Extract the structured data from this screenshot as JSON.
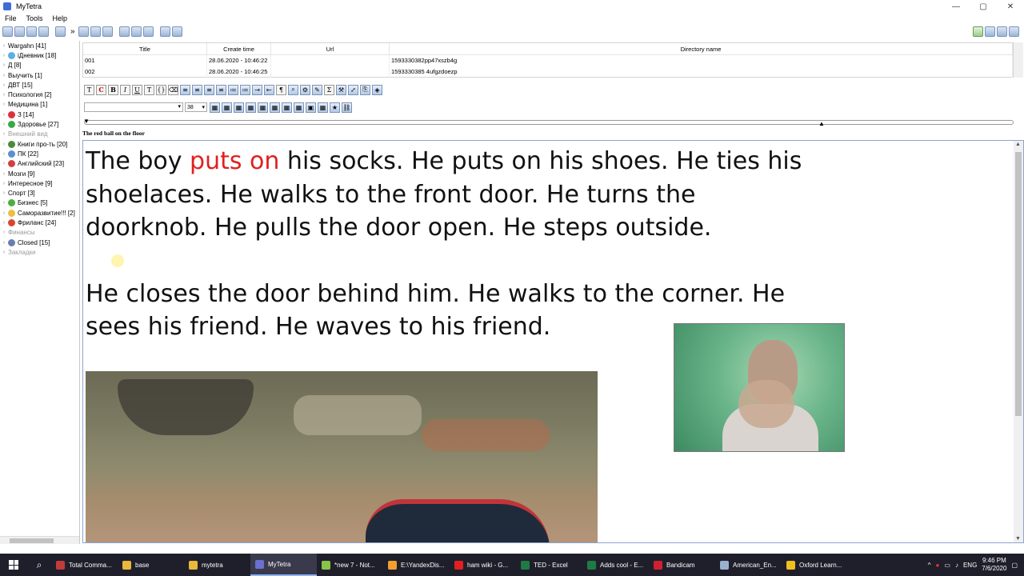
{
  "window": {
    "title": "MyTetra",
    "controls": [
      "—",
      "▢",
      "✕"
    ]
  },
  "menu": [
    "File",
    "Tools",
    "Help"
  ],
  "tree": [
    {
      "label": "Wargahn [41]",
      "icon": "",
      "grey": false
    },
    {
      "label": "iДневник [18]",
      "icon": "#5ab0e6",
      "grey": false
    },
    {
      "label": "Д [8]",
      "icon": "",
      "grey": false
    },
    {
      "label": "Выучить [1]",
      "icon": "",
      "grey": false
    },
    {
      "label": "ДВТ [15]",
      "icon": "",
      "grey": false
    },
    {
      "label": "Психология [2]",
      "icon": "",
      "grey": false
    },
    {
      "label": "Медицина [1]",
      "icon": "",
      "grey": false
    },
    {
      "label": "З [14]",
      "icon": "#e0303a",
      "grey": false
    },
    {
      "label": "Здоровье [27]",
      "icon": "#3aa845",
      "grey": false
    },
    {
      "label": "Внешний вид",
      "icon": "",
      "grey": true
    },
    {
      "label": "Книги про-ть [20]",
      "icon": "#4c8a3c",
      "grey": false
    },
    {
      "label": "ПК [22]",
      "icon": "#5a8fd0",
      "grey": false
    },
    {
      "label": "Английский [23]",
      "icon": "#d04040",
      "grey": false
    },
    {
      "label": "Мозги [9]",
      "icon": "",
      "grey": false
    },
    {
      "label": "Интересное [9]",
      "icon": "",
      "grey": false
    },
    {
      "label": "Спорт [3]",
      "icon": "",
      "grey": false
    },
    {
      "label": "Бизнес [5]",
      "icon": "#4fae3f",
      "grey": false
    },
    {
      "label": "Саморазвитие!!! [2]",
      "icon": "#e8c040",
      "grey": false
    },
    {
      "label": "Фриланс [24]",
      "icon": "#d9452f",
      "grey": false
    },
    {
      "label": "Финансы",
      "icon": "",
      "grey": true
    },
    {
      "label": "Closed [15]",
      "icon": "#6a7fb0",
      "grey": false
    },
    {
      "label": "Закладки",
      "icon": "",
      "grey": true
    }
  ],
  "records": {
    "headers": {
      "title": "Title",
      "time": "Create time",
      "url": "Url",
      "dir": "Directory name"
    },
    "rows": [
      {
        "title": "001",
        "time": "28.06.2020 - 10:46:22",
        "url": "",
        "dir": "1593330382pp47xszb4g"
      },
      {
        "title": "002",
        "time": "28.06.2020 - 10:46:25",
        "url": "",
        "dir": "1593330385 4ufgzdoezp"
      }
    ]
  },
  "format": {
    "font_size": "38"
  },
  "note": {
    "title": "The red ball on the floor",
    "p1_before": "The boy ",
    "p1_red": "puts on",
    "p1_after": " his socks. He puts on his shoes. He ties his shoelaces. He walks to the front door. He turns the doorknob. He pulls the door open. He steps outside.",
    "p2": "He closes the door behind him. He walks to the corner. He sees his friend. He waves to his friend."
  },
  "taskbar": {
    "items": [
      {
        "label": "Total Comma...",
        "color": "#c23b3b",
        "active": false
      },
      {
        "label": "base",
        "color": "#e8b83a",
        "active": false
      },
      {
        "label": "mytetra",
        "color": "#e8b83a",
        "active": false
      },
      {
        "label": "MyTetra",
        "color": "#6a6fd0",
        "active": true
      },
      {
        "label": "*new 7 - Not...",
        "color": "#8bc34a",
        "active": false
      },
      {
        "label": "E:\\YandexDis...",
        "color": "#f0a030",
        "active": false
      },
      {
        "label": "ham wiki - G...",
        "color": "#e02020",
        "active": false
      },
      {
        "label": "TED - Excel",
        "color": "#1e7b45",
        "active": false
      },
      {
        "label": "Adds cool - E...",
        "color": "#1e7b45",
        "active": false
      },
      {
        "label": "Bandicam",
        "color": "#d02030",
        "active": false
      },
      {
        "label": "American_En...",
        "color": "#9ab0d0",
        "active": false
      },
      {
        "label": "Oxford Learn...",
        "color": "#f0c020",
        "active": false
      }
    ],
    "lang": "ENG",
    "time": "9:46 PM",
    "date": "7/6/2020"
  }
}
